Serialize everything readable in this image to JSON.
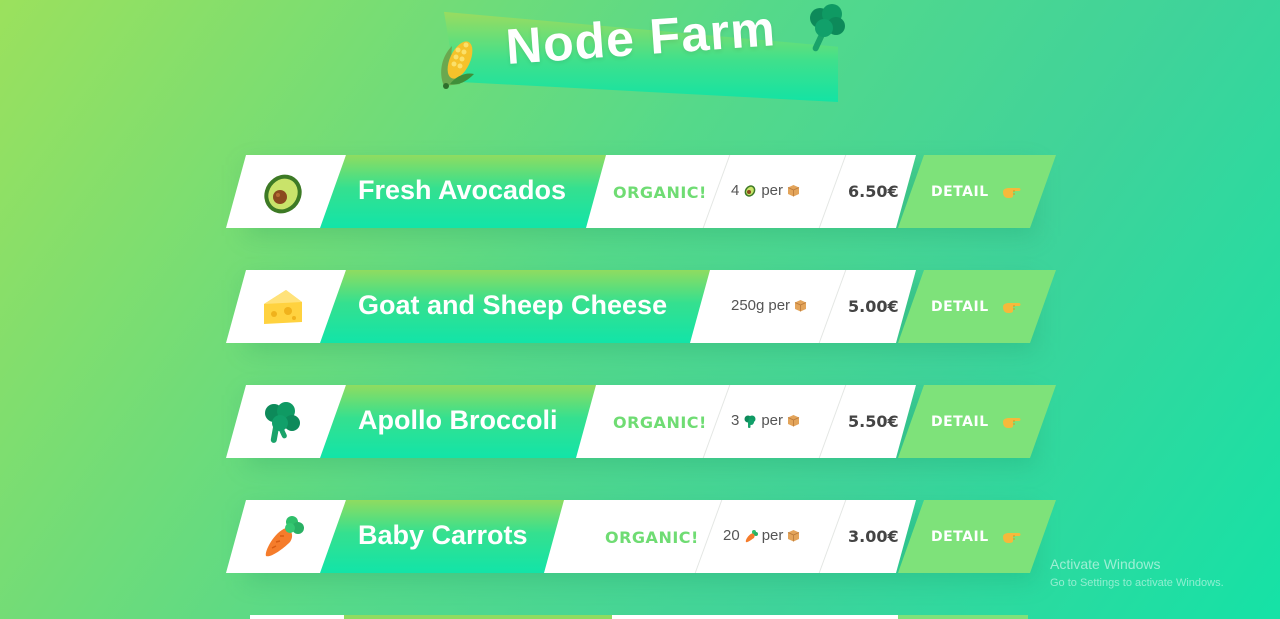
{
  "header": {
    "title": "Node Farm"
  },
  "products": [
    {
      "name": "Fresh Avocados",
      "icon": "avocado-icon",
      "organic": "ORGANIC!",
      "qty_prefix": "4",
      "qty_icon": "avocado-icon",
      "per": "per",
      "price": "6.50€",
      "detail": "DETAIL"
    },
    {
      "name": "Goat and Sheep Cheese",
      "icon": "cheese-icon",
      "organic": "",
      "qty_prefix": "250g",
      "qty_icon": "",
      "per": "per",
      "price": "5.00€",
      "detail": "DETAIL"
    },
    {
      "name": "Apollo Broccoli",
      "icon": "broccoli-icon",
      "organic": "ORGANIC!",
      "qty_prefix": "3",
      "qty_icon": "broccoli-icon",
      "per": "per",
      "price": "5.50€",
      "detail": "DETAIL"
    },
    {
      "name": "Baby Carrots",
      "icon": "carrot-icon",
      "organic": "ORGANIC!",
      "qty_prefix": "20",
      "qty_icon": "carrot-icon",
      "per": "per",
      "price": "3.00€",
      "detail": "DETAIL"
    }
  ],
  "watermark": {
    "title": "Activate Windows",
    "subtitle": "Go to Settings to activate Windows."
  },
  "colors": {
    "organic": "#6fdc73",
    "detail_bg": "#7ee27a",
    "brand_green": "#35e08f"
  }
}
